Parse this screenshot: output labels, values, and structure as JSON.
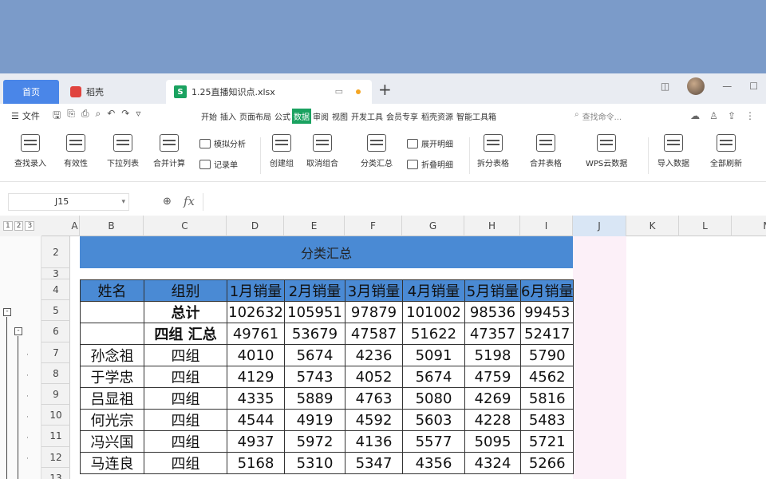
{
  "tabs": {
    "home": "首页",
    "docer": "稻壳",
    "file": "1.25直播知识点.xlsx",
    "file_icon": "S"
  },
  "menubar": {
    "file_label": "文件",
    "items": [
      "开始",
      "插入",
      "页面布局",
      "公式",
      "数据",
      "审阅",
      "视图",
      "开发工具",
      "会员专享",
      "稻壳资源",
      "智能工具箱"
    ],
    "active": "数据",
    "search_placeholder": "查找命令..."
  },
  "ribbon": {
    "find_entry": "查找录入",
    "validity": "有效性",
    "dropdown_list": "下拉列表",
    "consolidate": "合并计算",
    "whatif": "模拟分析",
    "record_form": "记录单",
    "create_group": "创建组",
    "ungroup": "取消组合",
    "subtotal": "分类汇总",
    "show_detail": "展开明细",
    "hide_detail": "折叠明细",
    "split_table": "拆分表格",
    "merge_table": "合并表格",
    "wps_cloud": "WPS云数据",
    "import_data": "导入数据",
    "refresh_all": "全部刷新"
  },
  "formula": {
    "cell_ref": "J15",
    "fx": "fx",
    "value": ""
  },
  "grid": {
    "outline_levels": [
      "1",
      "2",
      "3"
    ],
    "columns": [
      "A",
      "B",
      "C",
      "D",
      "E",
      "F",
      "G",
      "H",
      "I",
      "J",
      "K",
      "L",
      "M"
    ],
    "selected_column": "J",
    "rows": [
      "2",
      "3",
      "4",
      "5",
      "6",
      "7",
      "8",
      "9",
      "10",
      "11",
      "12",
      "13"
    ],
    "title": "分类汇总",
    "headers": [
      "姓名",
      "组别",
      "1月销量",
      "2月销量",
      "3月销量",
      "4月销量",
      "5月销量",
      "6月销量"
    ],
    "data": [
      [
        "",
        "总计",
        "102632",
        "105951",
        "97879",
        "101002",
        "98536",
        "99453"
      ],
      [
        "",
        "四组 汇总",
        "49761",
        "53679",
        "47587",
        "51622",
        "47357",
        "52417"
      ],
      [
        "孙念祖",
        "四组",
        "4010",
        "5674",
        "4236",
        "5091",
        "5198",
        "5790"
      ],
      [
        "于学忠",
        "四组",
        "4129",
        "5743",
        "4052",
        "5674",
        "4759",
        "4562"
      ],
      [
        "吕显祖",
        "四组",
        "4335",
        "5889",
        "4763",
        "5080",
        "4269",
        "5816"
      ],
      [
        "何光宗",
        "四组",
        "4544",
        "4919",
        "4592",
        "5603",
        "4228",
        "5483"
      ],
      [
        "冯兴国",
        "四组",
        "4937",
        "5972",
        "4136",
        "5577",
        "5095",
        "5721"
      ],
      [
        "马连良",
        "四组",
        "5168",
        "5310",
        "5347",
        "4356",
        "4324",
        "5266"
      ]
    ]
  },
  "colors": {
    "accent": "#1aa260",
    "header_fill": "#4a8ad4",
    "home_tab": "#4a86e8"
  }
}
